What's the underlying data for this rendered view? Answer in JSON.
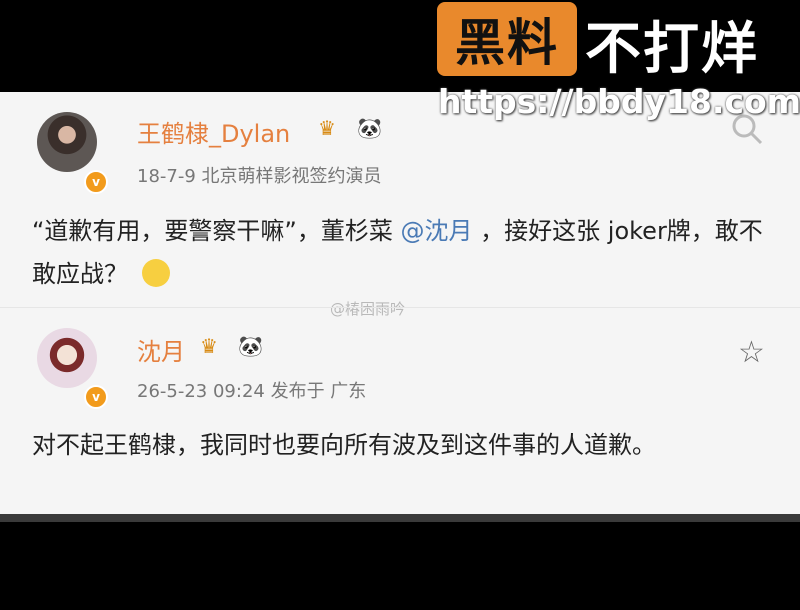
{
  "banner": {
    "badge": "黑料",
    "rest": "不打烊",
    "url": "https://bbdy18.com"
  },
  "post": {
    "name": "王鹤棣_Dylan",
    "meta": "18-7-9  北京萌样影视签约演员",
    "text_part1": "“道歉有用，要警察干嘛”，董杉菜",
    "mention": "@沈月",
    "text_part2": "，接好这张 joker牌，敢不敢应战？"
  },
  "reply": {
    "name": "沈月",
    "meta": "26-5-23 09:24  发布于 广东",
    "text": "对不起王鹤棣，我同时也要向所有波及到这件事的人道歉。"
  },
  "watermark_small": "@椿困雨吟",
  "icons": {
    "search": "search-icon",
    "star": "star-icon",
    "crown": "crown-icon",
    "panda": "panda-icon",
    "verified": "verified-badge-icon",
    "emoji": "emoji-icon"
  },
  "colors": {
    "name": "#e5803f",
    "mention": "#4a7ab5",
    "badge": "#e9892c",
    "verified": "#f29b1c"
  }
}
